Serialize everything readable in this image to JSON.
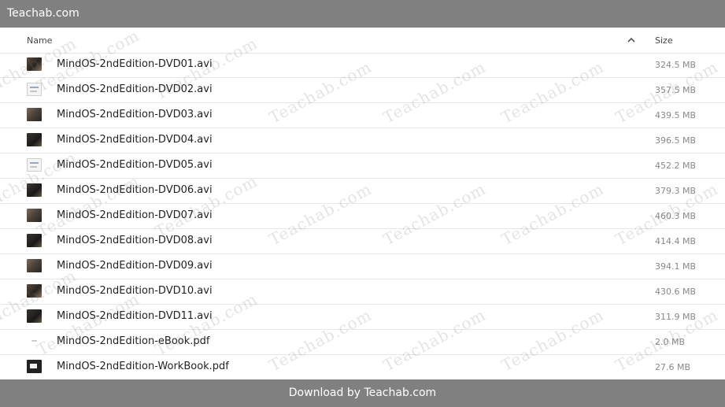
{
  "topbar": {
    "title": "Teachab.com"
  },
  "header": {
    "name_label": "Name",
    "size_label": "Size",
    "sort_icon": "chevron-up-icon"
  },
  "files": [
    {
      "name": "MindOS-2ndEdition-DVD01.avi",
      "size": "324.5 MB",
      "thumb": "video-thumbnail"
    },
    {
      "name": "MindOS-2ndEdition-DVD02.avi",
      "size": "357.5 MB",
      "thumb": "slide-thumbnail"
    },
    {
      "name": "MindOS-2ndEdition-DVD03.avi",
      "size": "439.5 MB",
      "thumb": "video-thumbnail"
    },
    {
      "name": "MindOS-2ndEdition-DVD04.avi",
      "size": "396.5 MB",
      "thumb": "video-thumbnail"
    },
    {
      "name": "MindOS-2ndEdition-DVD05.avi",
      "size": "452.2 MB",
      "thumb": "slide-thumbnail"
    },
    {
      "name": "MindOS-2ndEdition-DVD06.avi",
      "size": "379.3 MB",
      "thumb": "video-thumbnail"
    },
    {
      "name": "MindOS-2ndEdition-DVD07.avi",
      "size": "460.3 MB",
      "thumb": "video-thumbnail"
    },
    {
      "name": "MindOS-2ndEdition-DVD08.avi",
      "size": "414.4 MB",
      "thumb": "video-thumbnail"
    },
    {
      "name": "MindOS-2ndEdition-DVD09.avi",
      "size": "394.1 MB",
      "thumb": "video-thumbnail"
    },
    {
      "name": "MindOS-2ndEdition-DVD10.avi",
      "size": "430.6 MB",
      "thumb": "video-thumbnail"
    },
    {
      "name": "MindOS-2ndEdition-DVD11.avi",
      "size": "311.9 MB",
      "thumb": "video-thumbnail"
    },
    {
      "name": "MindOS-2ndEdition-eBook.pdf",
      "size": "2.0 MB",
      "thumb": "pdf-thumbnail"
    },
    {
      "name": "MindOS-2ndEdition-WorkBook.pdf",
      "size": "27.6 MB",
      "thumb": "pdf-thumbnail"
    }
  ],
  "watermark": "Teachab.com",
  "footer": {
    "text": "Download by Teachab.com"
  },
  "colors": {
    "bar": "#808080",
    "bar_text": "#ffffff",
    "row_border": "#e8e8e8",
    "size_text": "#888888"
  }
}
